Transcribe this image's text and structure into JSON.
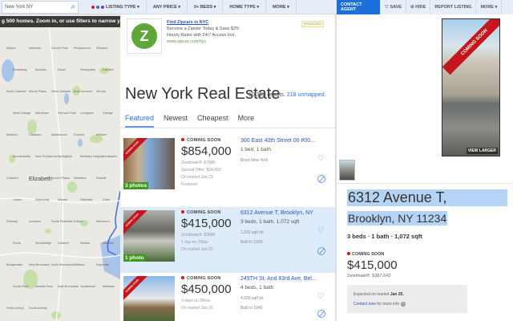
{
  "search": {
    "value": "New York NY"
  },
  "filters": {
    "dots": [
      "#e0141b",
      "#2a6fdb",
      "#8a2be2"
    ],
    "items": [
      "LISTING TYPE ▾",
      "ANY PRICE ▾",
      "0+ BEDS ▾",
      "HOME TYPE ▾",
      "MORE ▾"
    ]
  },
  "map": {
    "banner": "g 500 homes. Zoom in, or use filters to narrow yo",
    "labels": [
      "Wayne",
      "Montville",
      "Lincoln Park",
      "Pequannock",
      "Wharton",
      "Rockaway",
      "Boonton",
      "Dover",
      "Parsippany",
      "Fairfield",
      "North Caldwell",
      "Morris Plains",
      "West Caldwell",
      "East Hanover",
      "Verona",
      "West Orange",
      "Mendham",
      "Florham Park",
      "Livingston",
      "Orange",
      "Madison",
      "Chatham",
      "Maplewood",
      "Summit",
      "Millburn",
      "Bernardsville",
      "New Providence",
      "Springfield",
      "Berkeley Heights",
      "Kenilworth",
      "Cranford",
      "Elizabeth",
      "Scotch Plains",
      "Westfield",
      "Roselle",
      "Linden",
      "Watchung",
      "Warren",
      "Plainfield",
      "Clark",
      "Rahway",
      "Dunellen",
      "South Plainfield",
      "Edison",
      "Metuchen",
      "Fords",
      "Woodbridge",
      "Carteret",
      "Raritan",
      "Manville",
      "Bridgewater",
      "New Brunswick",
      "North Brunswick",
      "Milltown",
      "Sayreville",
      "South River",
      "Kendall Park",
      "East Brunswick",
      "Spotswood",
      "Matawan",
      "Perth Amboy",
      "South Amboy"
    ]
  },
  "ad": {
    "title": "Find Zipcars in NYC",
    "line1": "Become a Zipster Today & Save $25!",
    "line2": "Hourly Rates with 24/7 Access Incl.",
    "url": "www.zipcar.com/nyc",
    "sponsored": "SPONSORED",
    "logo": "Z"
  },
  "header": {
    "title": "New York Real Estate",
    "results": "60,352 results.",
    "unmapped": "218 unmapped."
  },
  "tabs": [
    "Featured",
    "Newest",
    "Cheapest",
    "More"
  ],
  "listings": [
    {
      "status": "COMING SOON",
      "price": "$854,000",
      "sub": [
        "Zestimate®: $788K",
        "Special Offer: $24,000",
        "On market Jan 23",
        "Featured"
      ],
      "address": "300 East 40th Street 00 #00...",
      "facts": "1 bed, 1 bath",
      "facts2": [
        "Bond New York"
      ],
      "photos": "3 photos",
      "ribbon": "COMING SOON"
    },
    {
      "status": "COMING SOON",
      "price": "$415,000",
      "sub": [
        "Zestimate®: $388K",
        "1 day on Zillow",
        "On market Jan 25"
      ],
      "address": "6312 Avenue T, Brooklyn, NY",
      "facts": "3 beds, 1 bath, 1,072 sqft",
      "facts2": [
        "1,933 sqft lot",
        "Built in 1930"
      ],
      "photos": "1 photo",
      "ribbon": "COMING SOON"
    },
    {
      "status": "COMING SOON",
      "price": "$450,000",
      "sub": [
        "3 days on Zillow",
        "On market Jan 26"
      ],
      "address": "249TH St. And 83rd Ave, Bel...",
      "facts": "4 beds, 1 bath",
      "facts2": [
        "4,000 sqft lot",
        "Built in 1945"
      ],
      "photos": "",
      "ribbon": "COMING SOON"
    }
  ],
  "detail": {
    "toolbar": {
      "contact": "CONTACT AGENT",
      "save": "♡ SAVE",
      "hide": "⊘ HIDE",
      "report": "REPORT LISTING",
      "more": "MORE ▾"
    },
    "ribbon": "COMING SOON",
    "view_larger": "VIEW LARGER",
    "address1": "6312 Avenue T,",
    "address2": "Brooklyn, NY 11234",
    "facts": "3 beds · 1 bath · 1,072 sqft",
    "status": "COMING SOON",
    "price": "$415,000",
    "zestimate": "Zestimate®: $387,643",
    "expected": "Expected on market",
    "expected_date": "Jan 25.",
    "contact_now": "Contact now",
    "more_info": "for more info",
    "help": "?"
  }
}
